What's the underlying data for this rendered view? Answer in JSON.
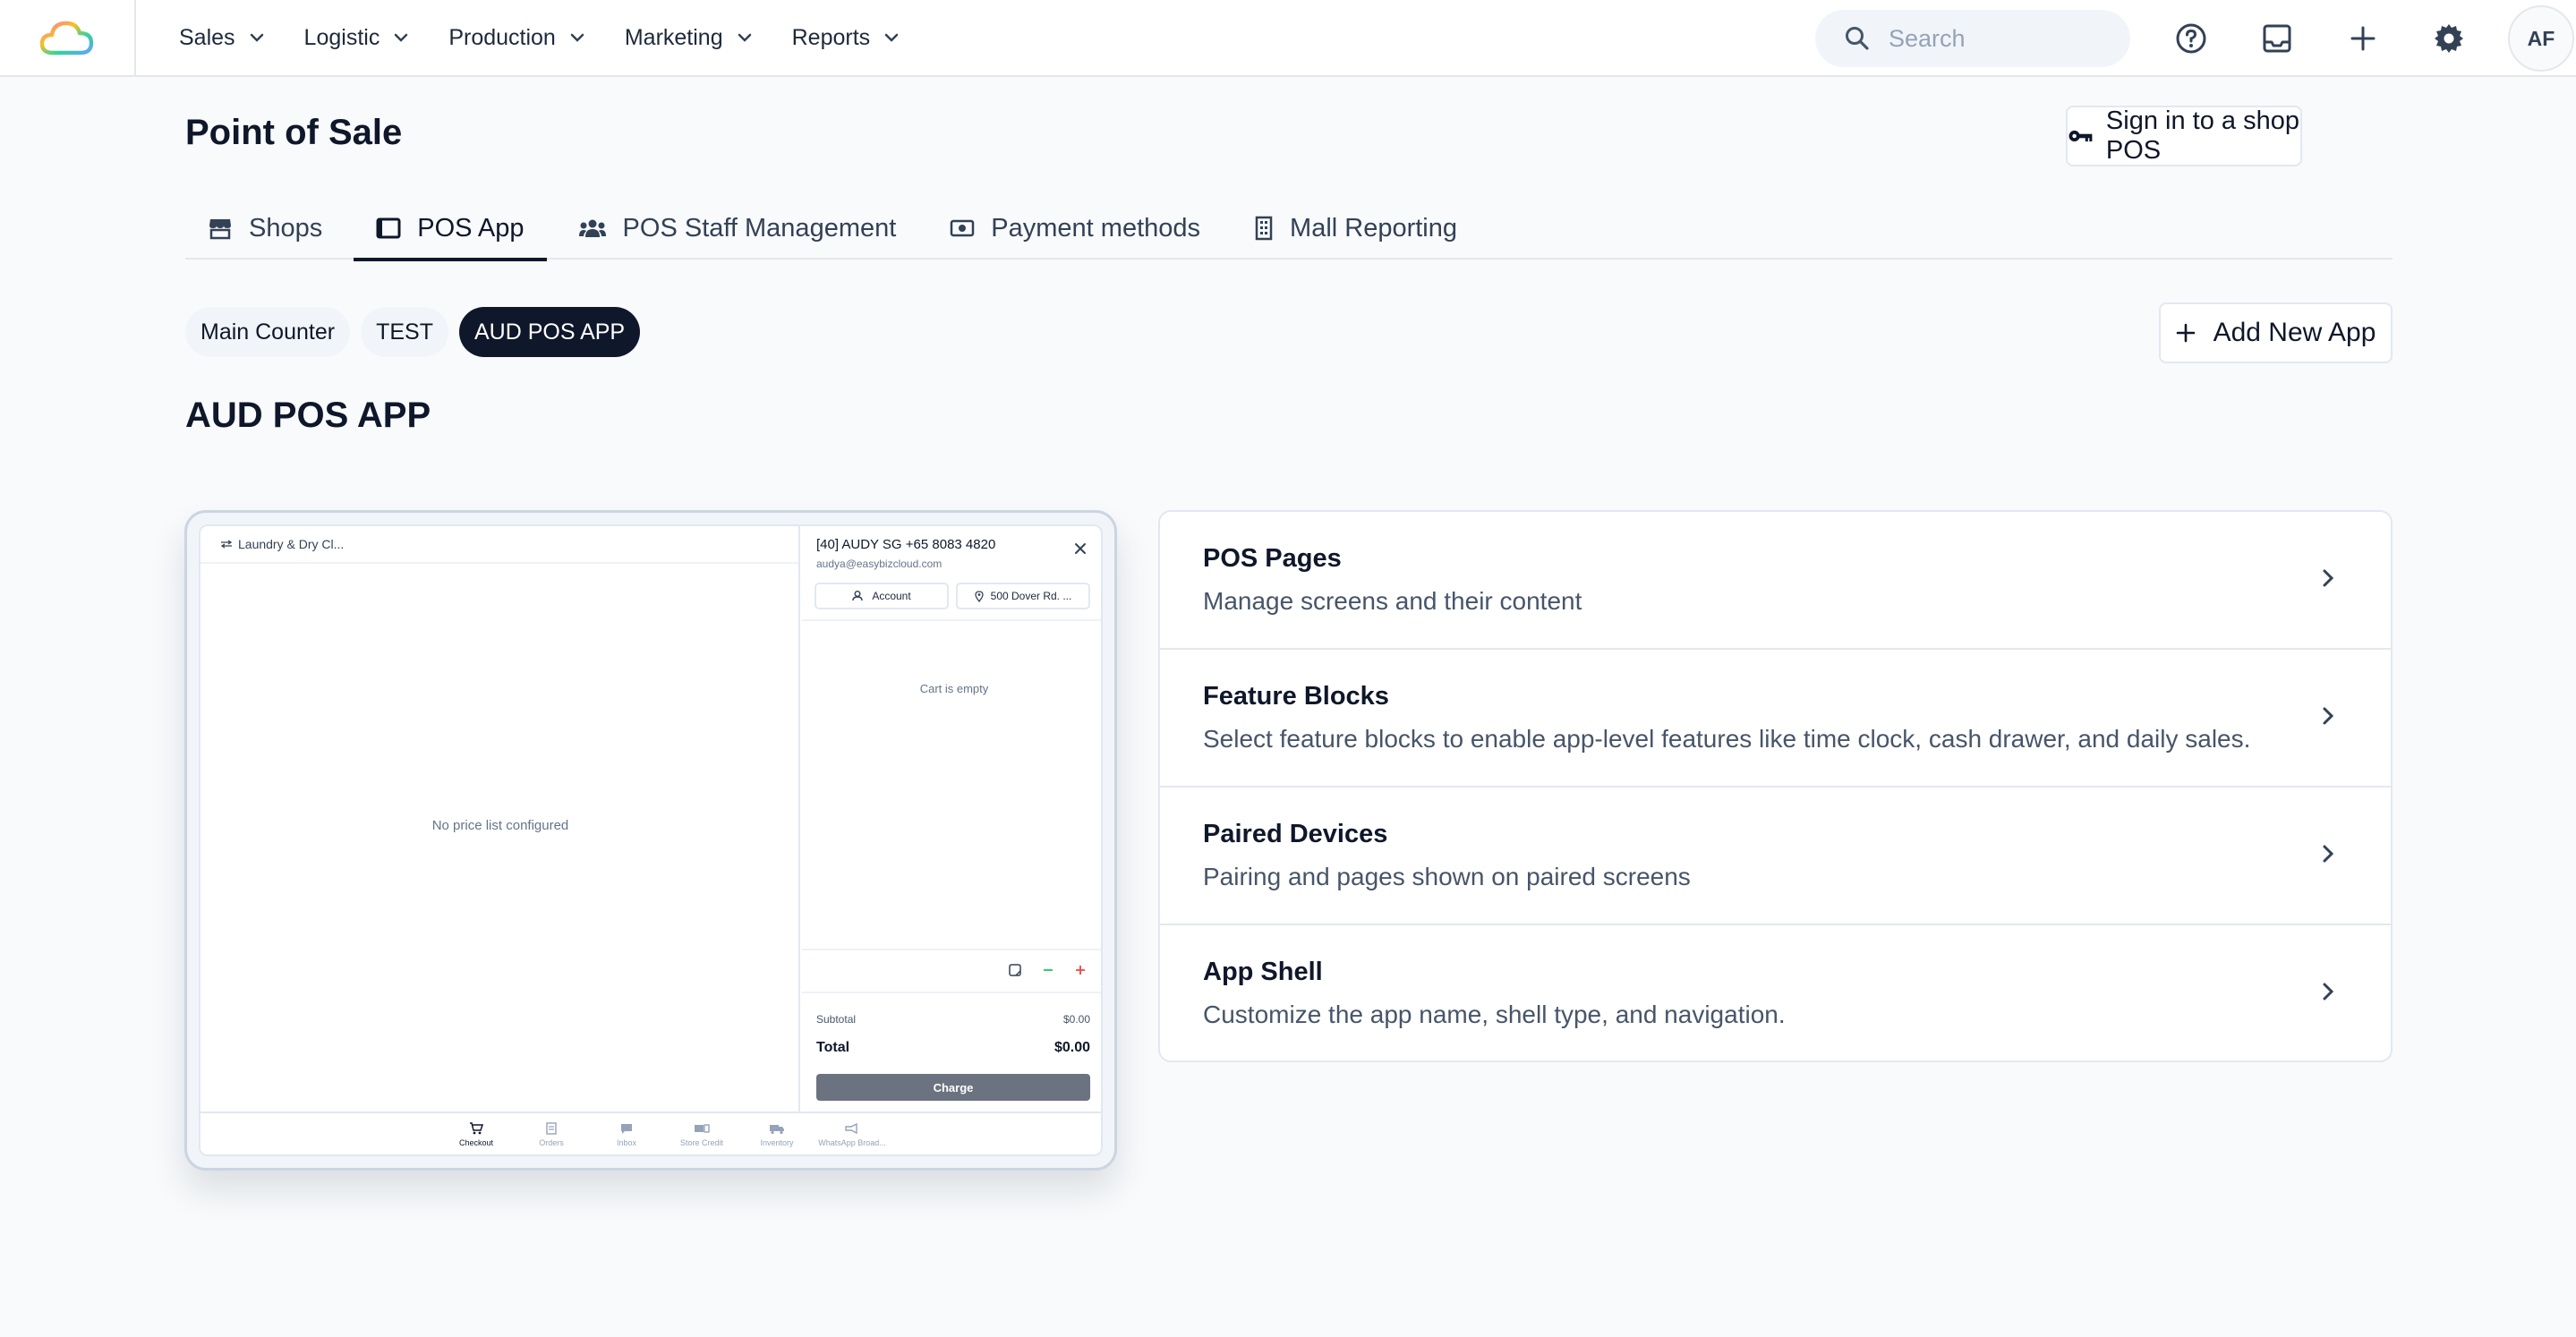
{
  "nav": {
    "menus": [
      {
        "label": "Sales"
      },
      {
        "label": "Logistic"
      },
      {
        "label": "Production"
      },
      {
        "label": "Marketing"
      },
      {
        "label": "Reports"
      }
    ],
    "search_placeholder": "Search",
    "avatar_initials": "AF"
  },
  "header": {
    "title": "Point of Sale",
    "signin_label": "Sign in to a shop POS"
  },
  "tabs": [
    {
      "label": "Shops",
      "icon": "store-icon"
    },
    {
      "label": "POS App",
      "icon": "tablet-icon",
      "active": true
    },
    {
      "label": "POS Staff Management",
      "icon": "users-icon"
    },
    {
      "label": "Payment methods",
      "icon": "cash-icon"
    },
    {
      "label": "Mall Reporting",
      "icon": "building-icon"
    }
  ],
  "apps": {
    "chips": [
      {
        "label": "Main Counter"
      },
      {
        "label": "TEST"
      },
      {
        "label": "AUD POS APP",
        "active": true
      }
    ],
    "add_label": "Add New App",
    "current_title": "AUD POS APP"
  },
  "preview": {
    "location": "Laundry & Dry Cl...",
    "no_price": "No price list configured",
    "customer_name": "[40] AUDY SG +65 8083 4820",
    "customer_email": "audya@easybizcloud.com",
    "account_label": "Account",
    "address_label": "500 Dover Rd. ...",
    "cart_empty": "Cart is empty",
    "subtotal_label": "Subtotal",
    "subtotal_value": "$0.00",
    "total_label": "Total",
    "total_value": "$0.00",
    "charge_label": "Charge",
    "bottom_nav": [
      {
        "label": "Checkout",
        "icon": "cart-icon",
        "active": true
      },
      {
        "label": "Orders",
        "icon": "orders-icon"
      },
      {
        "label": "Inbox",
        "icon": "chat-icon"
      },
      {
        "label": "Store Credit",
        "icon": "credit-icon"
      },
      {
        "label": "Inventory",
        "icon": "truck-icon"
      },
      {
        "label": "WhatsApp Broad...",
        "icon": "broadcast-icon"
      }
    ]
  },
  "settings": [
    {
      "title": "POS Pages",
      "desc": "Manage screens and their content"
    },
    {
      "title": "Feature Blocks",
      "desc": "Select feature blocks to enable app-level features like time clock, cash drawer, and daily sales."
    },
    {
      "title": "Paired Devices",
      "desc": "Pairing and pages shown on paired screens"
    },
    {
      "title": "App Shell",
      "desc": "Customize the app name, shell type, and navigation."
    }
  ],
  "colors": {
    "primary": "#0f172a",
    "border": "#e2e8f0",
    "muted_text": "#475569",
    "background": "#f8fafc",
    "charge_button": "#6b7280"
  }
}
